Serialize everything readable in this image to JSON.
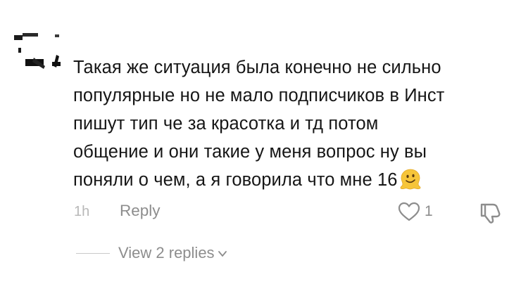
{
  "comment": {
    "text": "Такая же ситуация была конечно не сильно\nпопулярные но не мало подписчиков в Инст\nпишут тип че за красотка и тд потом\nобщение и они такие у меня вопрос ну вы\nпоняли о чем, а я говорила что мне 16",
    "emoji": "melting-face-emoji",
    "avatar": "redacted-avatar"
  },
  "meta": {
    "timestamp": "1h",
    "reply_label": "Reply",
    "like_icon": "heart-outline-icon",
    "like_count": "1",
    "dislike_icon": "thumbs-down-icon"
  },
  "replies": {
    "label": "View 2 replies",
    "icon": "chevron-down-icon"
  },
  "colors": {
    "text": "#161616",
    "muted": "#8d8d8d",
    "timestamp": "#b8b8b8",
    "emoji": "#f6c53a"
  }
}
